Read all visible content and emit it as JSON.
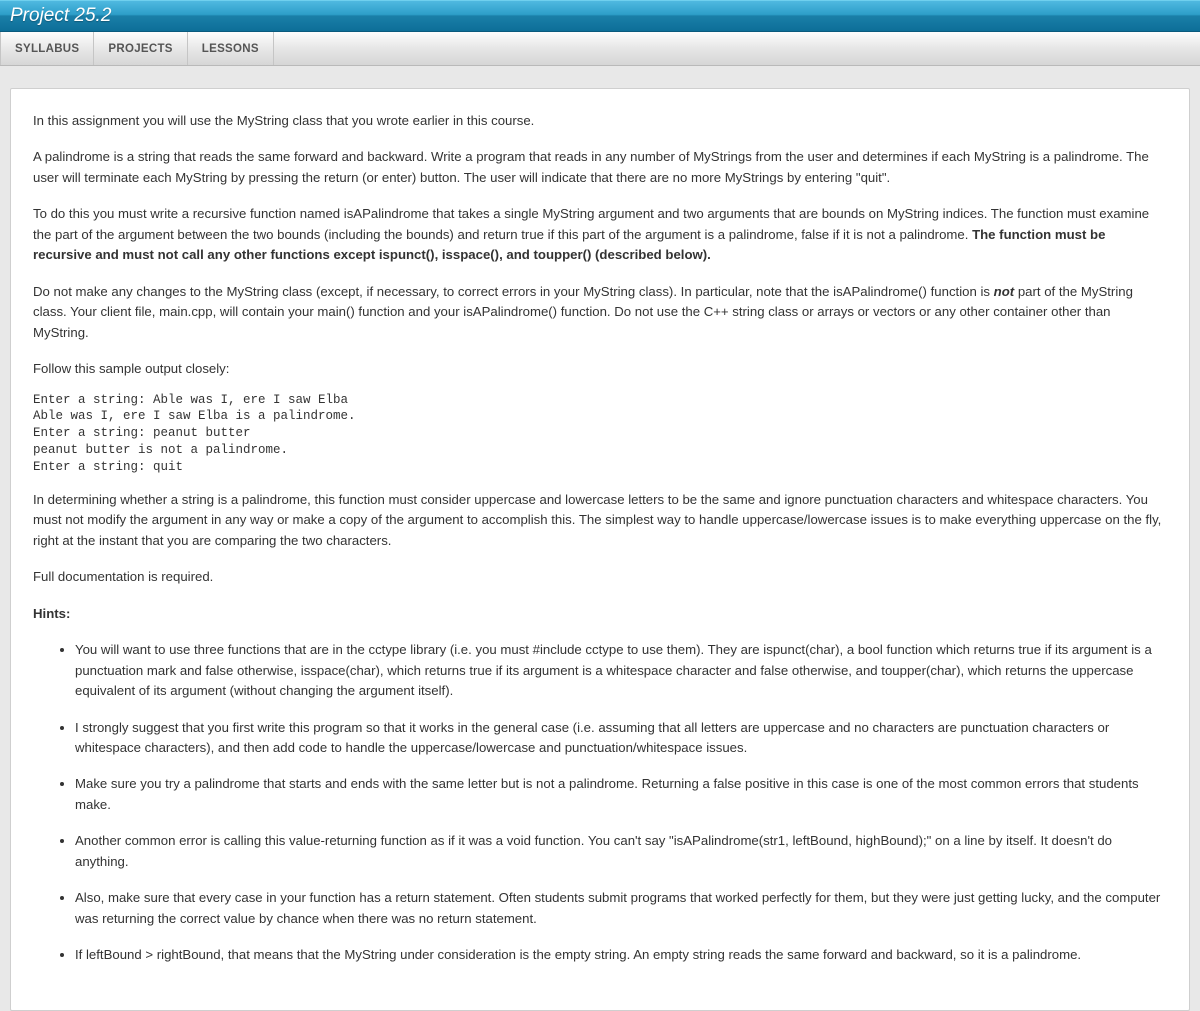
{
  "header": {
    "title": "Project 25.2"
  },
  "tabs": [
    {
      "label": "SYLLABUS"
    },
    {
      "label": "PROJECTS"
    },
    {
      "label": "LESSONS"
    }
  ],
  "content": {
    "p1": "In this assignment you will use the MyString class that you wrote earlier in this course.",
    "p2": "A palindrome is a string that reads the same forward and backward. Write a program that reads in any number of MyStrings from the user and determines if each MyString is a palindrome. The user will terminate each MyString by pressing the return (or enter) button. The user will indicate that there are no more MyStrings by entering \"quit\".",
    "p3_a": "To do this you must write a recursive function named isAPalindrome that takes a single MyString argument and two arguments that are bounds on MyString indices. The function must examine the part of the argument between the two bounds (including the bounds) and return true if this part of the argument is a palindrome, false if it is not a palindrome. ",
    "p3_bold": "The function must be recursive and must not call any other functions except ispunct(), isspace(), and toupper() (described below).",
    "p4_a": "Do not make any changes to the MyString class (except, if necessary, to correct errors in your MyString class). In particular, note that the isAPalindrome() function is ",
    "p4_not": "not",
    "p4_b": " part of the MyString class. Your client file, main.cpp, will contain your main() function and your isAPalindrome() function. Do not use the C++ string class or arrays or vectors or any other container other than MyString.",
    "p5": "Follow this sample output closely:",
    "sample": "Enter a string: Able was I, ere I saw Elba\nAble was I, ere I saw Elba is a palindrome.\nEnter a string: peanut butter\npeanut butter is not a palindrome.\nEnter a string: quit",
    "p6": "In determining whether a string is a palindrome, this function must consider uppercase and lowercase letters to be the same and ignore punctuation characters and whitespace characters. You must not modify the argument in any way or make a copy of the argument to accomplish this. The simplest way to handle uppercase/lowercase issues is to make everything uppercase on the fly, right at the instant that you are comparing the two characters.",
    "p7": "Full documentation is required.",
    "hints_label": "Hints:",
    "hints": [
      "You will want to use three functions that are in the cctype library (i.e. you must #include cctype to use them). They are ispunct(char), a bool function which returns true if its argument is a punctuation mark and false otherwise, isspace(char), which returns true if its argument is a whitespace character and false otherwise, and toupper(char), which returns the uppercase equivalent of its argument (without changing the argument itself).",
      "I strongly suggest that you first write this program so that it works in the general case (i.e. assuming that all letters are uppercase and no characters are punctuation characters or whitespace characters), and then add code to handle the uppercase/lowercase and punctuation/whitespace issues.",
      "Make sure you try a palindrome that starts and ends with the same letter but is not a palindrome. Returning a false positive in this case is one of the most common errors that students make.",
      "Another common error is calling this value-returning function as if it was a void function. You can't say \"isAPalindrome(str1, leftBound, highBound);\" on a line by itself. It doesn't do anything.",
      "Also, make sure that every case in your function has a return statement. Often students submit programs that worked perfectly for them, but they were just getting lucky, and the computer was returning the correct value by chance when there was no return statement.",
      "If leftBound > rightBound, that means that the MyString under consideration is the empty string. An empty string reads the same forward and backward, so it is a palindrome."
    ]
  }
}
